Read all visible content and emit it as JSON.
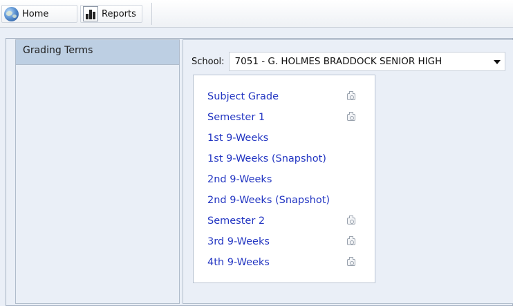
{
  "toolbar": {
    "home_label": "Home",
    "reports_label": "Reports",
    "home_icon": "globe-icon",
    "reports_icon": "bar-chart-icon"
  },
  "sidebar": {
    "header": "Grading Terms"
  },
  "main": {
    "school_label": "School:",
    "school_value": "7051 - G. HOLMES BRADDOCK SENIOR HIGH",
    "terms": [
      {
        "label": "Subject Grade",
        "camera": true
      },
      {
        "label": "Semester 1",
        "camera": true
      },
      {
        "label": "1st 9-Weeks",
        "camera": false
      },
      {
        "label": "1st 9-Weeks (Snapshot)",
        "camera": false
      },
      {
        "label": "2nd 9-Weeks",
        "camera": false
      },
      {
        "label": "2nd 9-Weeks (Snapshot)",
        "camera": false
      },
      {
        "label": "Semester 2",
        "camera": true
      },
      {
        "label": "3rd 9-Weeks",
        "camera": true
      },
      {
        "label": "4th 9-Weeks",
        "camera": true
      }
    ]
  },
  "colors": {
    "link": "#2336c2",
    "background": "#eaeff7",
    "sidebar_header": "#bdcfe3"
  }
}
